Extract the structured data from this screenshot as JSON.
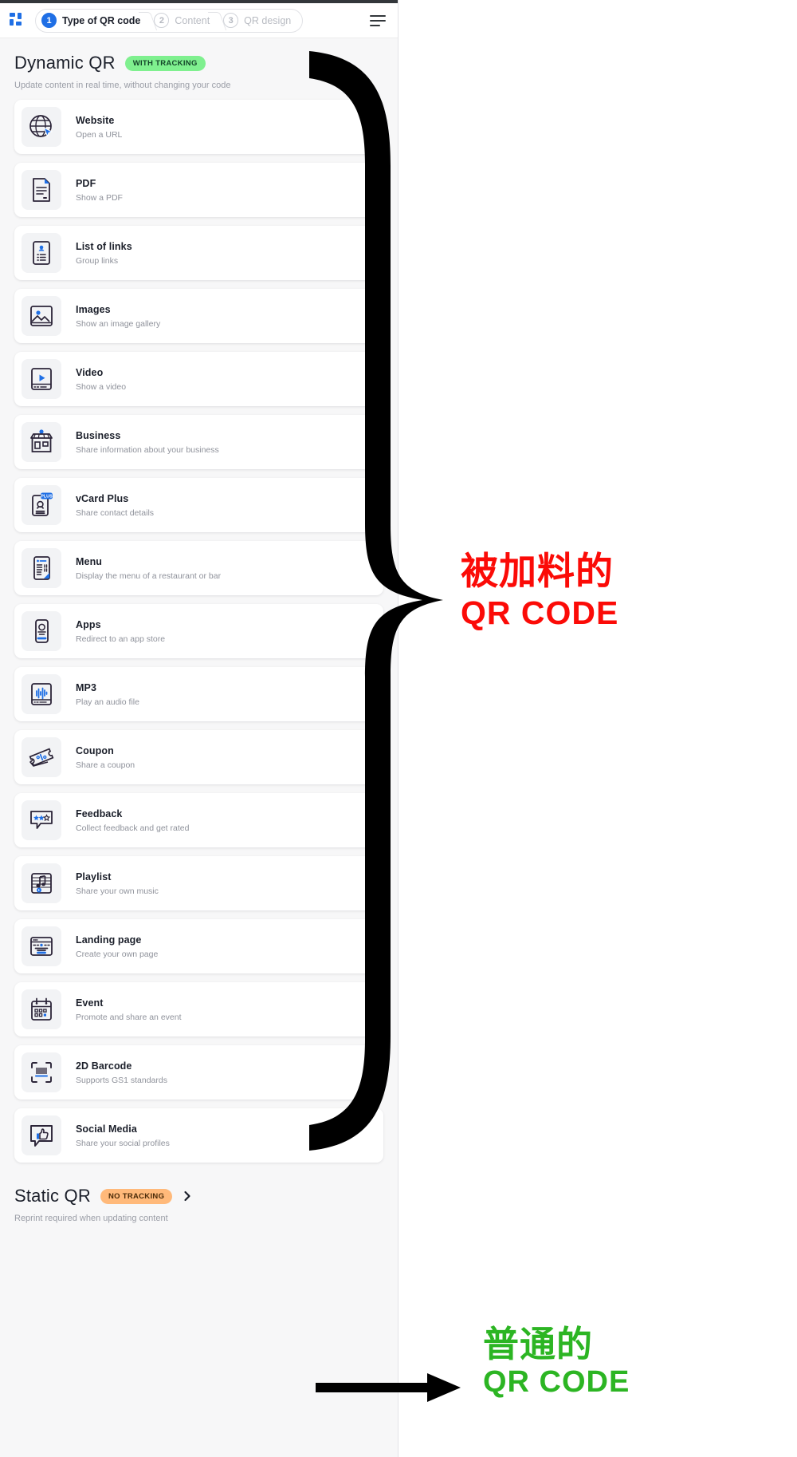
{
  "wizard": {
    "logo_icon": "grid-logo-icon",
    "menu_icon": "hamburger-menu-icon",
    "steps": [
      {
        "num": "1",
        "label": "Type of QR code"
      },
      {
        "num": "2",
        "label": "Content"
      },
      {
        "num": "3",
        "label": "QR design"
      }
    ]
  },
  "dynamic": {
    "title": "Dynamic QR",
    "badge": "WITH TRACKING",
    "subtitle": "Update content in real time, without changing your code",
    "items": [
      {
        "title": "Website",
        "desc": "Open a URL",
        "icon": "globe-icon"
      },
      {
        "title": "PDF",
        "desc": "Show a PDF",
        "icon": "pdf-document-icon"
      },
      {
        "title": "List of links",
        "desc": "Group links",
        "icon": "list-of-links-icon"
      },
      {
        "title": "Images",
        "desc": "Show an image gallery",
        "icon": "image-gallery-icon"
      },
      {
        "title": "Video",
        "desc": "Show a video",
        "icon": "video-player-icon"
      },
      {
        "title": "Business",
        "desc": "Share information about your business",
        "icon": "storefront-icon"
      },
      {
        "title": "vCard Plus",
        "desc": "Share contact details",
        "icon": "vcard-plus-icon"
      },
      {
        "title": "Menu",
        "desc": "Display the menu of a restaurant or bar",
        "icon": "restaurant-menu-icon"
      },
      {
        "title": "Apps",
        "desc": "Redirect to an app store",
        "icon": "mobile-app-icon"
      },
      {
        "title": "MP3",
        "desc": "Play an audio file",
        "icon": "audio-waveform-icon"
      },
      {
        "title": "Coupon",
        "desc": "Share a coupon",
        "icon": "coupon-ticket-icon"
      },
      {
        "title": "Feedback",
        "desc": "Collect feedback and get rated",
        "icon": "star-rating-bubble-icon"
      },
      {
        "title": "Playlist",
        "desc": "Share your own music",
        "icon": "music-playlist-icon"
      },
      {
        "title": "Landing page",
        "desc": "Create your own page",
        "icon": "browser-window-icon"
      },
      {
        "title": "Event",
        "desc": "Promote and share an event",
        "icon": "calendar-icon"
      },
      {
        "title": "2D Barcode",
        "desc": "Supports GS1 standards",
        "icon": "barcode-scan-icon"
      },
      {
        "title": "Social Media",
        "desc": "Share your social profiles",
        "icon": "thumbs-up-bubble-icon"
      }
    ]
  },
  "static": {
    "title": "Static QR",
    "badge": "NO TRACKING",
    "chevron_icon": "chevron-right-icon",
    "subtitle": "Reprint required when updating content"
  },
  "annotations": {
    "dynamic_callout": {
      "line1": "被加料的",
      "line2": "QR CODE",
      "color": "#fb0b07",
      "pointer": "curly-brace-icon"
    },
    "static_callout": {
      "line1": "普通的",
      "line2": "QR CODE",
      "color": "#2cb523",
      "pointer": "arrow-right-icon"
    }
  }
}
